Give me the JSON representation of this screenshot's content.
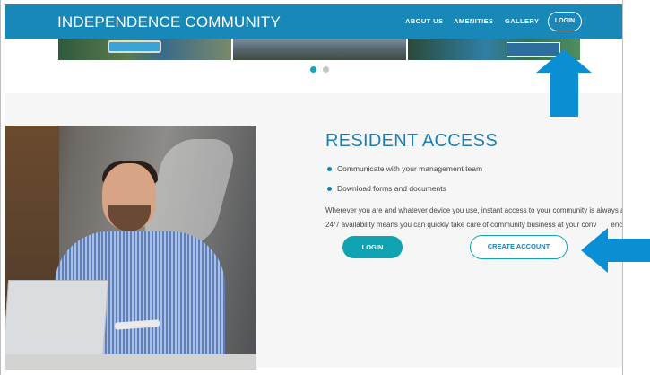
{
  "header": {
    "brand": "INDEPENDENCE COMMUNITY",
    "nav": [
      "ABOUT US",
      "AMENITIES",
      "GALLERY"
    ],
    "login_label": "LOGIN"
  },
  "carousel": {
    "dots": 2,
    "active_index": 0
  },
  "resident": {
    "title": "RESIDENT ACCESS",
    "bullets": [
      "Communicate with your management team",
      "Download forms and documents"
    ],
    "paragraph_line1": "Wherever you are and whatever device you use, instant access to your community is always a",
    "paragraph_line2": "24/7 availability means you can quickly take care of community business at your conv",
    "paragraph_line2_end": "ence",
    "login_button": "LOGIN",
    "create_button": "CREATE ACCOUNT"
  },
  "colors": {
    "navbar": "#1788b8",
    "title": "#1b7fb5",
    "button": "#12a3b2",
    "arrow": "#0b8fd4"
  }
}
